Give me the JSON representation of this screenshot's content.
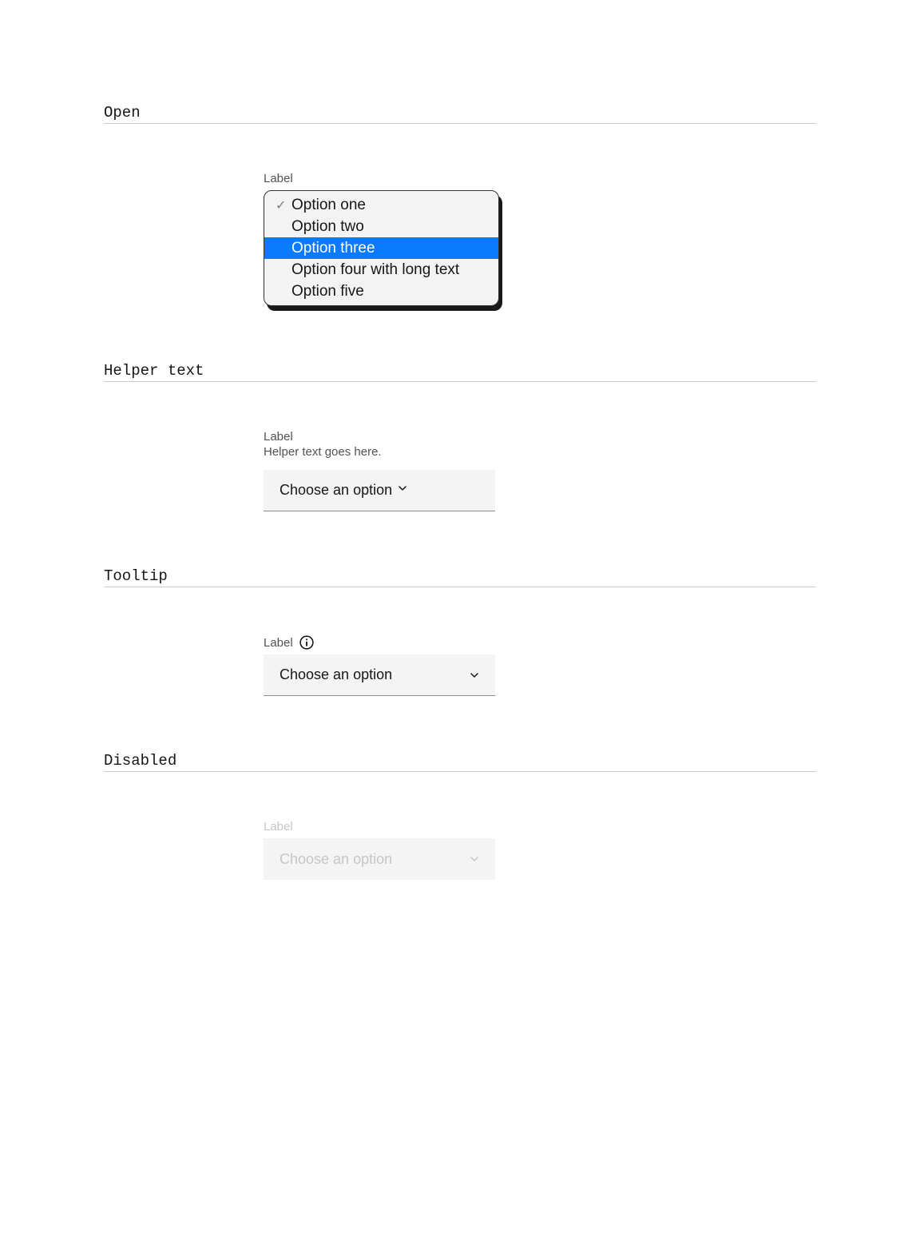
{
  "sections": {
    "open": {
      "heading": "Open",
      "label": "Label",
      "options": [
        {
          "text": "Option one",
          "checked": true,
          "highlighted": false
        },
        {
          "text": "Option two",
          "checked": false,
          "highlighted": false
        },
        {
          "text": "Option three",
          "checked": false,
          "highlighted": true
        },
        {
          "text": "Option four with long text",
          "checked": false,
          "highlighted": false
        },
        {
          "text": "Option five",
          "checked": false,
          "highlighted": false
        }
      ]
    },
    "helper": {
      "heading": "Helper text",
      "label": "Label",
      "helper_text": "Helper text goes here.",
      "placeholder": "Choose an option"
    },
    "tooltip": {
      "heading": "Tooltip",
      "label": "Label",
      "placeholder": "Choose an option"
    },
    "disabled": {
      "heading": "Disabled",
      "label": "Label",
      "placeholder": "Choose an option"
    }
  }
}
